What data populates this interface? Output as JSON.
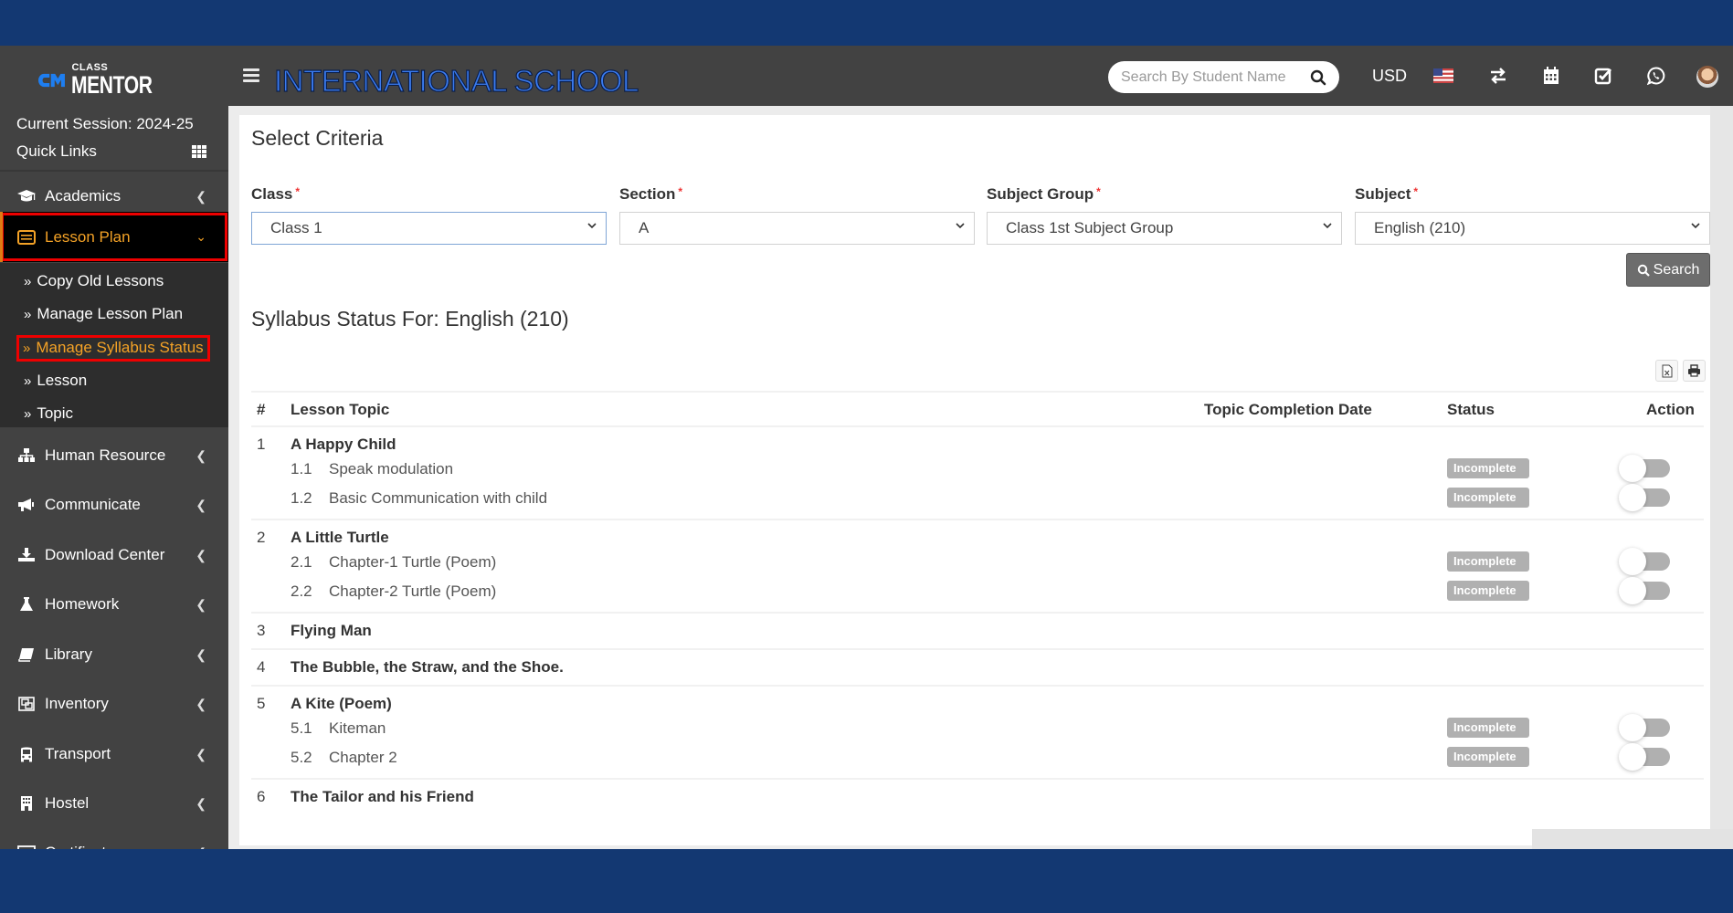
{
  "header": {
    "logo_small": "CLASS",
    "logo_big": "MENTOR",
    "school_name": "INTERNATIONAL SCHOOL",
    "search_placeholder": "Search By Student Name",
    "currency": "USD",
    "icons": [
      "flag-us-icon",
      "exchange-icon",
      "calendar-icon",
      "check-square-icon",
      "whatsapp-icon",
      "avatar"
    ]
  },
  "sidebar": {
    "session": "Current Session: 2024-25",
    "quick_links": "Quick Links",
    "items": [
      {
        "label": "Academics",
        "icon": "graduation-cap-icon"
      },
      {
        "label": "Lesson Plan",
        "icon": "book-list-icon",
        "active": true
      },
      {
        "label": "Human Resource",
        "icon": "sitemap-icon"
      },
      {
        "label": "Communicate",
        "icon": "bullhorn-icon"
      },
      {
        "label": "Download Center",
        "icon": "download-icon"
      },
      {
        "label": "Homework",
        "icon": "flask-icon"
      },
      {
        "label": "Library",
        "icon": "book-icon"
      },
      {
        "label": "Inventory",
        "icon": "object-group-icon"
      },
      {
        "label": "Transport",
        "icon": "bus-icon"
      },
      {
        "label": "Hostel",
        "icon": "building-icon"
      },
      {
        "label": "Certificate",
        "icon": "certificate-icon"
      }
    ],
    "subitems": [
      {
        "label": "Copy Old Lessons"
      },
      {
        "label": "Manage Lesson Plan"
      },
      {
        "label": "Manage Syllabus Status",
        "active": true
      },
      {
        "label": "Lesson"
      },
      {
        "label": "Topic"
      }
    ]
  },
  "criteria": {
    "title": "Select Criteria",
    "fields": [
      {
        "label": "Class",
        "value": "Class 1"
      },
      {
        "label": "Section",
        "value": "A"
      },
      {
        "label": "Subject Group",
        "value": "Class 1st Subject Group"
      },
      {
        "label": "Subject",
        "value": "English (210)"
      }
    ],
    "search_label": "Search"
  },
  "syllabus": {
    "title": "Syllabus Status For: English (210)",
    "columns": [
      "#",
      "Lesson Topic",
      "Topic Completion Date",
      "Status",
      "Action"
    ],
    "lessons": [
      {
        "num": "1",
        "title": "A Happy Child",
        "topics": [
          {
            "num": "1.1",
            "name": "Speak modulation",
            "date": "",
            "status": "Incomplete",
            "complete": false
          },
          {
            "num": "1.2",
            "name": "Basic Communication with child",
            "date": "",
            "status": "Incomplete",
            "complete": false
          }
        ]
      },
      {
        "num": "2",
        "title": "A Little Turtle",
        "topics": [
          {
            "num": "2.1",
            "name": "Chapter-1 Turtle (Poem)",
            "date": "",
            "status": "Incomplete",
            "complete": false
          },
          {
            "num": "2.2",
            "name": "Chapter-2 Turtle (Poem)",
            "date": "",
            "status": "Incomplete",
            "complete": false
          }
        ]
      },
      {
        "num": "3",
        "title": "Flying Man",
        "topics": []
      },
      {
        "num": "4",
        "title": "The Bubble, the Straw, and the Shoe.",
        "topics": []
      },
      {
        "num": "5",
        "title": "A Kite (Poem)",
        "topics": [
          {
            "num": "5.1",
            "name": "Kiteman",
            "date": "",
            "status": "Incomplete",
            "complete": false
          },
          {
            "num": "5.2",
            "name": "Chapter 2",
            "date": "",
            "status": "Incomplete",
            "complete": false
          }
        ]
      },
      {
        "num": "6",
        "title": "The Tailor and his Friend",
        "topics": []
      }
    ]
  },
  "colors": {
    "frame_blue": "#133872",
    "header_bg": "#424242",
    "active_orange": "#f4a226",
    "highlight_red": "#e00000",
    "badge_gray": "#b0b0b0"
  }
}
